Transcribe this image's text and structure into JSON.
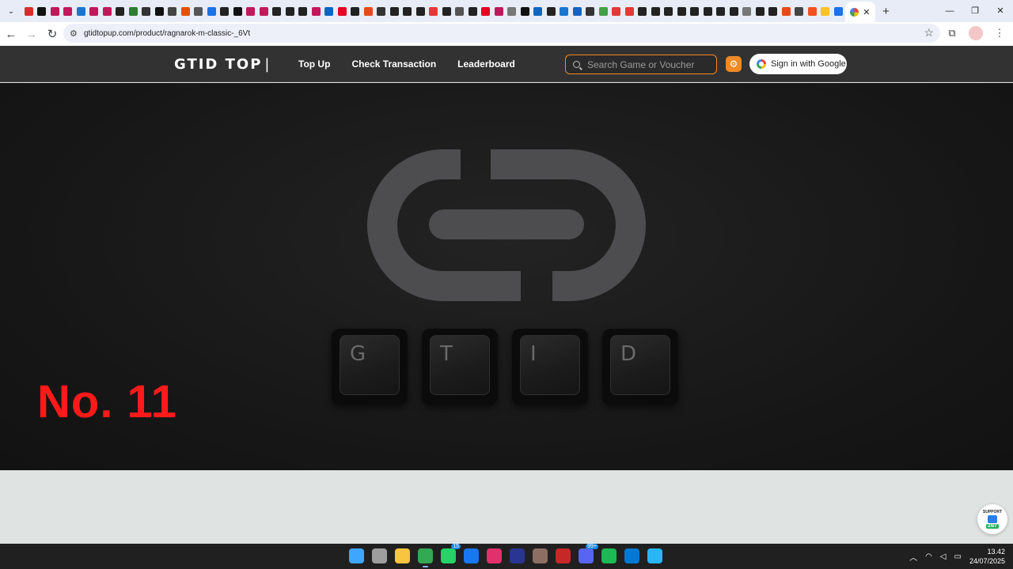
{
  "browser": {
    "active_tab_favicon": "google-icon",
    "close_tab_glyph": "✕",
    "new_tab_glyph": "+",
    "url": "gtidtopup.com/product/ragnarok-m-classic-_6Vt",
    "window_controls": [
      "—",
      "❐",
      "✕"
    ],
    "tab_favicon_colors": [
      "#d32f2f",
      "#111111",
      "#c2185b",
      "#c2185b",
      "#1976d2",
      "#c2185b",
      "#c2185b",
      "#222222",
      "#2e7d32",
      "#333333",
      "#111111",
      "#444444",
      "#e65100",
      "#555555",
      "#1a73e8",
      "#222222",
      "#111111",
      "#c2185b",
      "#c2185b",
      "#222222",
      "#222222",
      "#222222",
      "#c2185b",
      "#0a66c2",
      "#e60023",
      "#222222",
      "#e64a19",
      "#333333",
      "#222222",
      "#222222",
      "#222222",
      "#e53935",
      "#222222",
      "#555555",
      "#222222",
      "#e60023",
      "#c2185b",
      "#777777",
      "#111111",
      "#1565c0",
      "#222222",
      "#1976d2",
      "#1565c0",
      "#333333",
      "#43a047",
      "#e53935",
      "#e53935",
      "#222222",
      "#222222",
      "#222222",
      "#222222",
      "#222222",
      "#222222",
      "#222222",
      "#222222",
      "#777777",
      "#222222",
      "#222222",
      "#e64a19",
      "#444444",
      "#f4511e",
      "#fbc02d",
      "#1a73e8"
    ]
  },
  "header": {
    "logo": "GTID TOP",
    "logo_cursor": "|",
    "nav": [
      "Top Up",
      "Check Transaction",
      "Leaderboard"
    ],
    "search_placeholder": "Search Game or Voucher",
    "signin_label": "Sign in with Google",
    "accent_color": "#f08a24"
  },
  "hero": {
    "keys": [
      "G",
      "T",
      "I",
      "D"
    ],
    "rank_label": "No. 11",
    "rank_color": "#ff1a1a"
  },
  "support": {
    "top": "SUPPORT",
    "bottom": "24/7"
  },
  "taskbar": {
    "apps": [
      {
        "name": "windows-start-icon",
        "color": "#3ea6ff"
      },
      {
        "name": "task-view-icon",
        "color": "#9e9e9e"
      },
      {
        "name": "file-explorer-icon",
        "color": "#f9c440"
      },
      {
        "name": "chrome-icon",
        "color": "#34a853",
        "active": true
      },
      {
        "name": "whatsapp-icon",
        "color": "#25d366",
        "badge": "15"
      },
      {
        "name": "facebook-icon",
        "color": "#1877f2"
      },
      {
        "name": "instagram-icon",
        "color": "#e1306c"
      },
      {
        "name": "l-app-icon",
        "color": "#283593"
      },
      {
        "name": "ragnarok-icon",
        "color": "#8d6e63"
      },
      {
        "name": "adobe-app-icon",
        "color": "#c62828"
      },
      {
        "name": "discord-icon",
        "color": "#5865f2",
        "badge": "99+"
      },
      {
        "name": "spotify-icon",
        "color": "#1db954"
      },
      {
        "name": "vscode-icon",
        "color": "#0078d4"
      },
      {
        "name": "paint-icon",
        "color": "#29b6f6"
      }
    ],
    "time": "13.42",
    "date": "24/07/2025"
  }
}
